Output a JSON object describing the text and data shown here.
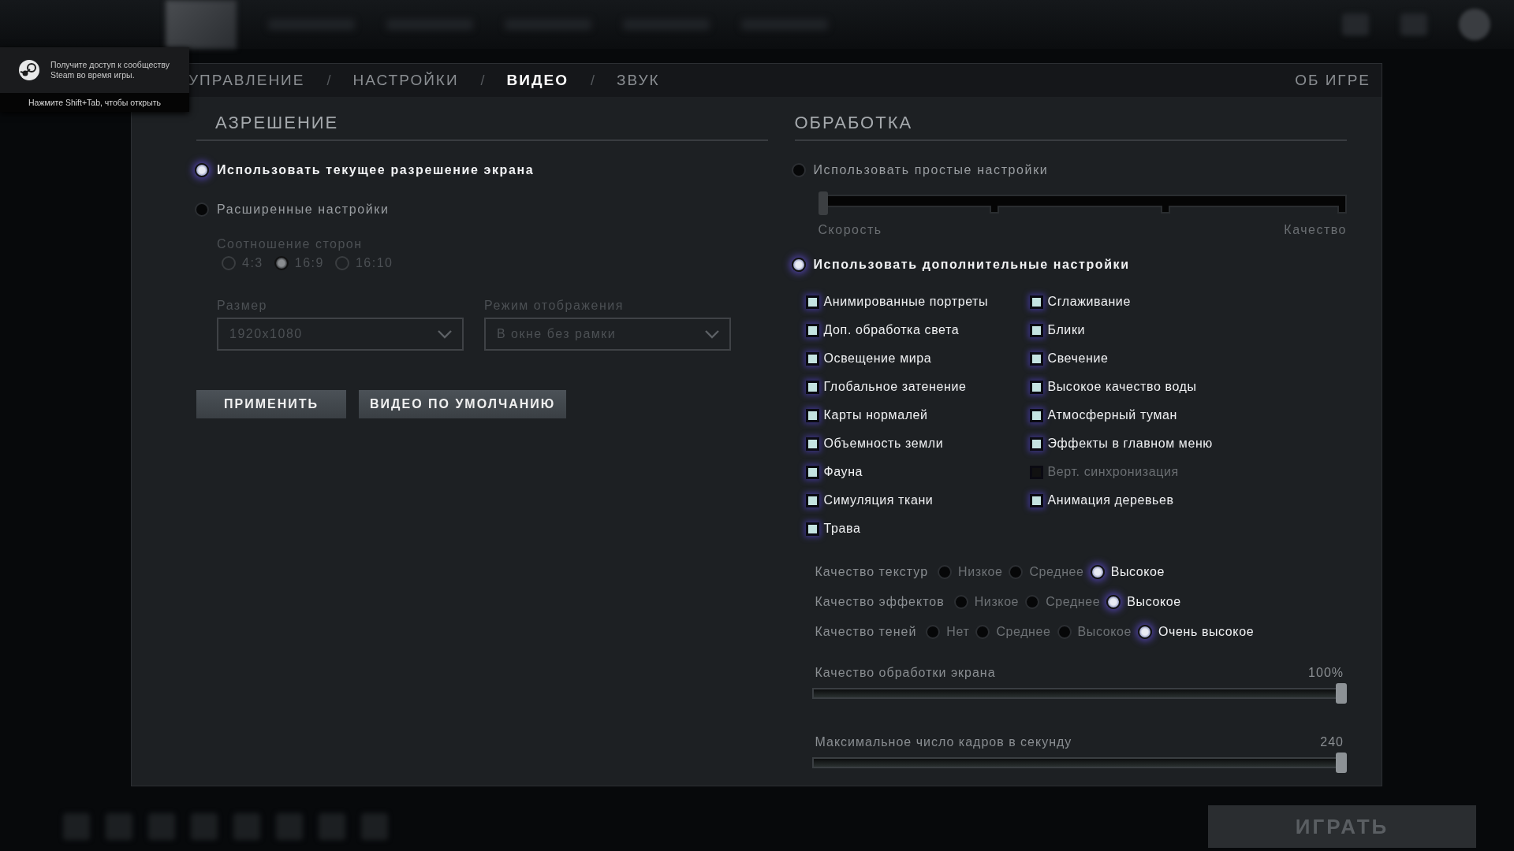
{
  "steam_popup": {
    "message": "Получите доступ к сообществу Steam во время игры.",
    "hint": "Нажмите Shift+Tab, чтобы открыть"
  },
  "tabs": [
    {
      "label": "УПРАВЛЕНИЕ",
      "selected": false
    },
    {
      "label": "НАСТРОЙКИ",
      "selected": false
    },
    {
      "label": "ВИДЕО",
      "selected": true
    },
    {
      "label": "ЗВУК",
      "selected": false
    }
  ],
  "tab_separator": "/",
  "about": "ОБ ИГРЕ",
  "resolution": {
    "heading": "АЗРЕШЕНИЕ",
    "options": [
      {
        "label": "Использовать текущее разрешение экрана",
        "selected": true
      },
      {
        "label": "Расширенные настройки",
        "selected": false
      }
    ],
    "aspect_label": "Соотношение сторон",
    "aspects": [
      {
        "label": "4:3",
        "selected": false
      },
      {
        "label": "16:9",
        "selected": true
      },
      {
        "label": "16:10",
        "selected": false
      }
    ],
    "size": {
      "label": "Размер",
      "value": "1920x1080"
    },
    "mode": {
      "label": "Режим отображения",
      "value": "В окне без рамки"
    },
    "buttons": [
      "ПРИМЕНИТЬ",
      "ВИДЕО ПО УМОЛЧАНИЮ"
    ]
  },
  "rendering": {
    "heading": "ОБРАБОТКА",
    "simple": {
      "label": "Использовать простые настройки",
      "selected": false,
      "level": 0,
      "min_label": "Скорость",
      "max_label": "Качество"
    },
    "advanced": {
      "label": "Использовать дополнительные настройки",
      "selected": true
    },
    "checkboxes_left": [
      {
        "label": "Анимированные портреты",
        "checked": true
      },
      {
        "label": "Доп. обработка света",
        "checked": true
      },
      {
        "label": "Освещение мира",
        "checked": true
      },
      {
        "label": "Глобальное затенение",
        "checked": true
      },
      {
        "label": "Карты нормалей",
        "checked": true
      },
      {
        "label": "Объемность земли",
        "checked": true
      },
      {
        "label": "Фауна",
        "checked": true
      },
      {
        "label": "Симуляция ткани",
        "checked": true
      },
      {
        "label": "Трава",
        "checked": true
      }
    ],
    "checkboxes_right": [
      {
        "label": "Сглаживание",
        "checked": true
      },
      {
        "label": "Блики",
        "checked": true
      },
      {
        "label": "Свечение",
        "checked": true
      },
      {
        "label": "Высокое качество воды",
        "checked": true
      },
      {
        "label": "Атмосферный туман",
        "checked": true
      },
      {
        "label": "Эффекты в главном меню",
        "checked": true
      },
      {
        "label": "Верт. синхронизация",
        "checked": false
      },
      {
        "label": "Анимация деревьев",
        "checked": true
      }
    ],
    "quality_rows": [
      {
        "label": "Качество текстур",
        "options": [
          {
            "label": "Низкое",
            "selected": false
          },
          {
            "label": "Среднее",
            "selected": false
          },
          {
            "label": "Высокое",
            "selected": true
          }
        ]
      },
      {
        "label": "Качество эффектов",
        "options": [
          {
            "label": "Низкое",
            "selected": false
          },
          {
            "label": "Среднее",
            "selected": false
          },
          {
            "label": "Высокое",
            "selected": true
          }
        ]
      },
      {
        "label": "Качество теней",
        "options": [
          {
            "label": "Нет",
            "selected": false
          },
          {
            "label": "Среднее",
            "selected": false
          },
          {
            "label": "Высокое",
            "selected": false
          },
          {
            "label": "Очень высокое",
            "selected": true
          }
        ]
      }
    ],
    "sliders": [
      {
        "label": "Качество обработки экрана",
        "reading": "100%",
        "level": 1
      },
      {
        "label": "Максимальное число кадров в секунду",
        "reading": "240",
        "level": 1
      }
    ]
  },
  "play_button": "ИГРАТЬ"
}
